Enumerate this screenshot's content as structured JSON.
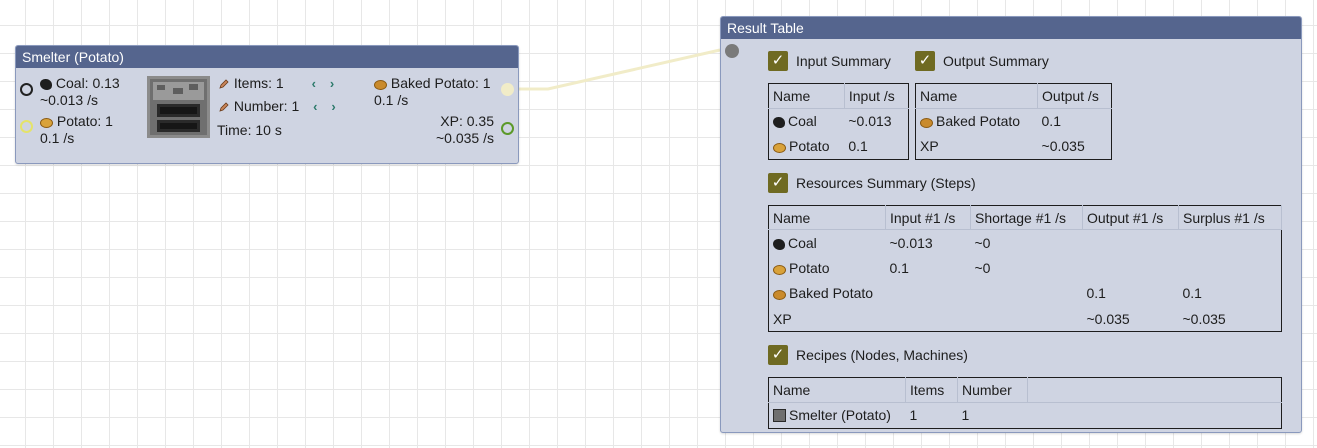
{
  "smelter": {
    "title": "Smelter (Potato)",
    "inputs": [
      {
        "icon": "coal-icon",
        "label": "Coal: 0.13",
        "rate": "~0.013 /s"
      },
      {
        "icon": "potato-icon",
        "label": "Potato: 1",
        "rate": "0.1 /s"
      }
    ],
    "items_label": "Items: 1",
    "number_label": "Number: 1",
    "time_label": "Time:  10 s",
    "outputs": [
      {
        "icon": "baked-potato-icon",
        "label": "Baked Potato: 1",
        "rate": "0.1 /s"
      },
      {
        "label": "XP: 0.35",
        "rate": "~0.035 /s"
      }
    ],
    "arrow_left": "‹",
    "arrow_right": "›"
  },
  "result": {
    "title": "Result Table",
    "input_summary": {
      "label": "Input Summary",
      "headers": [
        "Name",
        "Input /s"
      ],
      "rows": [
        {
          "icon": "coal-icon",
          "name": "Coal",
          "value": "~0.013"
        },
        {
          "icon": "potato-icon",
          "name": "Potato",
          "value": "0.1"
        }
      ]
    },
    "output_summary": {
      "label": "Output Summary",
      "headers": [
        "Name",
        "Output /s"
      ],
      "rows": [
        {
          "icon": "baked-potato-icon",
          "name": "Baked Potato",
          "value": "0.1"
        },
        {
          "icon": "",
          "name": "XP",
          "value": "~0.035"
        }
      ]
    },
    "resources_summary": {
      "label": "Resources Summary (Steps)",
      "headers": [
        "Name",
        "Input #1 /s",
        "Shortage #1 /s",
        "Output #1 /s",
        "Surplus #1 /s"
      ],
      "rows": [
        {
          "icon": "coal-icon",
          "name": "Coal",
          "input": "~0.013",
          "shortage": "~0",
          "output": "",
          "surplus": ""
        },
        {
          "icon": "potato-icon",
          "name": "Potato",
          "input": "0.1",
          "shortage": "~0",
          "output": "",
          "surplus": ""
        },
        {
          "icon": "baked-potato-icon",
          "name": "Baked Potato",
          "input": "",
          "shortage": "",
          "output": "0.1",
          "surplus": "0.1"
        },
        {
          "icon": "",
          "name": "XP",
          "input": "",
          "shortage": "",
          "output": "~0.035",
          "surplus": "~0.035"
        }
      ]
    },
    "recipes": {
      "label": "Recipes (Nodes, Machines)",
      "headers": [
        "Name",
        "Items",
        "Number"
      ],
      "rows": [
        {
          "icon": "furnace-icon",
          "name": "Smelter (Potato)",
          "items": "1",
          "number": "1"
        }
      ]
    },
    "check_glyph": "✓"
  }
}
